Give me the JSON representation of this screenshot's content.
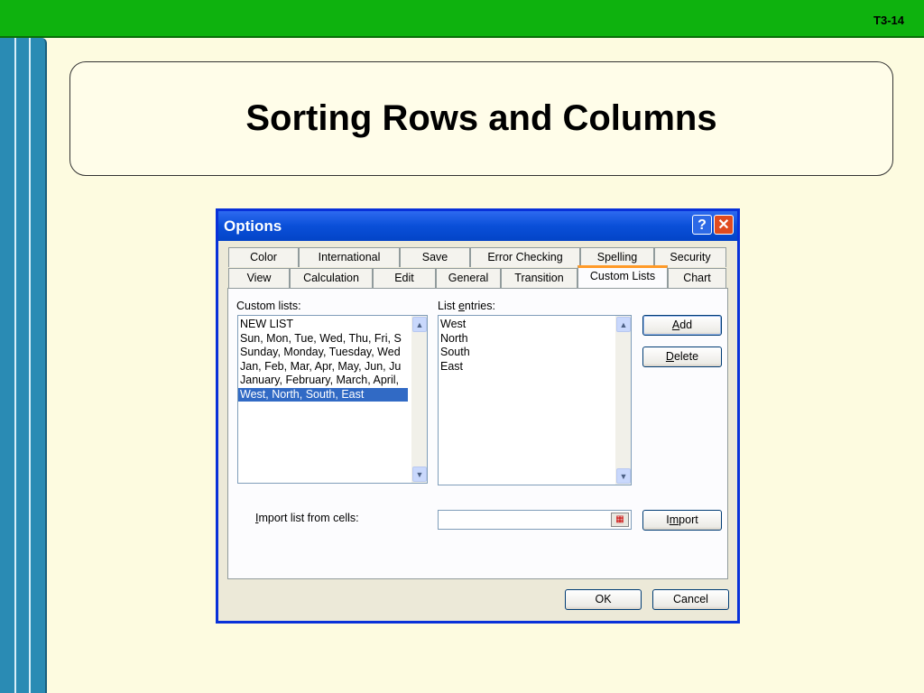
{
  "slide": {
    "number": "T3-14",
    "title": "Sorting Rows and Columns"
  },
  "dialog": {
    "title": "Options",
    "help_icon": "help-icon",
    "close_icon": "close-icon",
    "tabs_row1": [
      "Color",
      "International",
      "Save",
      "Error Checking",
      "Spelling",
      "Security"
    ],
    "tabs_row2": [
      "View",
      "Calculation",
      "Edit",
      "General",
      "Transition",
      "Custom Lists",
      "Chart"
    ],
    "active_tab": "Custom Lists",
    "custom_lists": {
      "label": "Custom lists:",
      "items": [
        "NEW LIST",
        "Sun, Mon, Tue, Wed, Thu, Fri, S",
        "Sunday, Monday, Tuesday, Wed",
        "Jan, Feb, Mar, Apr, May, Jun, Ju",
        "January, February, March, April,",
        "West, North, South, East"
      ],
      "selected": "West, North, South, East"
    },
    "list_entries": {
      "label": "List entries:",
      "items": [
        "West",
        "North",
        "South",
        "East"
      ]
    },
    "buttons": {
      "add": "Add",
      "delete": "Delete",
      "import": "Import",
      "ok": "OK",
      "cancel": "Cancel"
    },
    "import_label": "Import list from cells:",
    "import_value": ""
  }
}
